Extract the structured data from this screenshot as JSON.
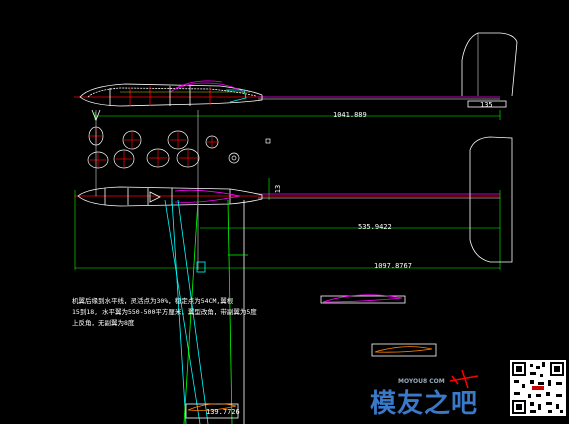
{
  "drawing": {
    "dims": {
      "fuselage_length": "1041.889",
      "stab_chord": "135",
      "wing_root": "535.9422",
      "wingspan_partial": "1097.8767",
      "vertical_small": "13",
      "airfoil_chord": "139.7726"
    },
    "note_text": "机翼后缘到水平线，灵活点为30%，稳定点为54CM,翼根\n15到18, 水平翼为550-500平方厘米，翼型改角，带副翼为5度\n上反角，无副翼为8度",
    "watermark": {
      "main": "模友之吧",
      "small": "MOYOU8 COM"
    },
    "colors": {
      "background": "#000000",
      "line_white": "#ffffff",
      "line_green": "#00ff00",
      "line_cyan": "#00ffff",
      "line_red": "#ff0000",
      "line_magenta": "#ff00ff",
      "line_yellow": "#ffff00",
      "line_orange": "#ff8000"
    }
  }
}
